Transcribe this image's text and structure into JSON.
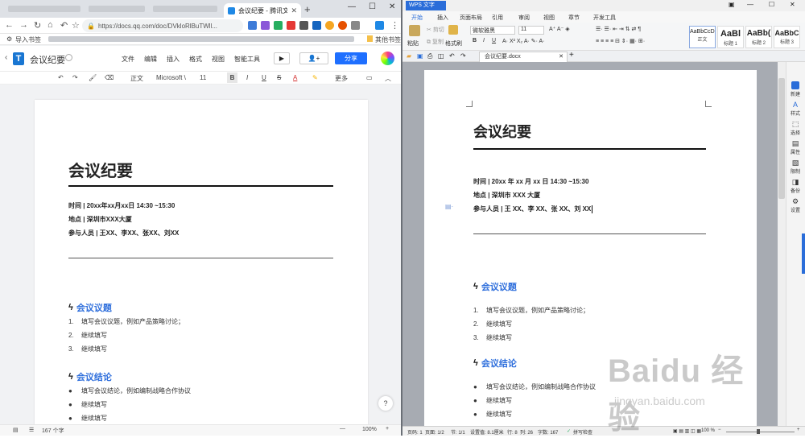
{
  "browser": {
    "tab_title": "会议纪要 - 腾讯文档",
    "url": "https://docs.qq.com/doc/DVkloRlBuTWll...",
    "bookmarks": {
      "import": "导入书签",
      "other": "其他书签"
    },
    "colors": {
      "tab_bg": "#dee1e6",
      "tab_icon": "#1e88e5"
    }
  },
  "tencent_doc": {
    "title": "会议纪要",
    "menu": [
      "文件",
      "编辑",
      "插入",
      "格式",
      "视图",
      "智能工具"
    ],
    "share_label": "分享",
    "toolbar": {
      "style": "正文",
      "font": "Microsoft \\",
      "size": "11",
      "more": "更多"
    },
    "status": {
      "word_count": "167 个字",
      "zoom": "100%"
    },
    "help_label": "?",
    "colors": {
      "brand": "#1976d2",
      "share": "#1e6fff",
      "section": "#2f6fdc"
    }
  },
  "doc_left": {
    "heading": "会议纪要",
    "time": "时间 | 20xx年xx月xx日  14:30 ~15:30",
    "place": "地点 | 深圳市XXX大厦",
    "people": "参与人员 | 王XX、李XX、张XX、刘XX",
    "topics_title": "会议议题",
    "topics": [
      "填写会议议题，例如产品策略讨论；",
      "继续填写",
      "继续填写"
    ],
    "conclusion_title": "会议结论",
    "conclusions": [
      "填写会议结论，例如编制战略合作协议",
      "继续填写",
      "继续填写"
    ]
  },
  "wps": {
    "app_badge": "WPS 文字",
    "ribbon_tabs": [
      "开始",
      "插入",
      "页面布局",
      "引用",
      "审阅",
      "视图",
      "章节",
      "开发工具"
    ],
    "ribbon": {
      "paste": "粘贴",
      "cut": "剪切",
      "copy": "复制",
      "format_painter": "格式刷",
      "font": "微软雅黑",
      "size": "11"
    },
    "styles": [
      {
        "preview": "AaBbCcDd",
        "name": "正文"
      },
      {
        "preview": "AaBl",
        "name": "标题 1"
      },
      {
        "preview": "AaBb(",
        "name": "标题 2"
      },
      {
        "preview": "AaBbC",
        "name": "标题 3"
      }
    ],
    "doc_tab": "会议纪要.docx",
    "side_panel": [
      "新建",
      "样式",
      "选择",
      "属性",
      "限制",
      "备份",
      "设置"
    ],
    "status": {
      "page": "页码: 1",
      "pages": "页面: 1/2",
      "section": "节: 1/1",
      "setting": "设置值: 8.1厘米",
      "row": "行: 8",
      "col": "列: 26",
      "words": "字数: 167",
      "spell": "拼写检查",
      "zoom": "100 %"
    },
    "colors": {
      "brand": "#2a6dd9",
      "canvas": "#a7abb2"
    }
  },
  "doc_right": {
    "heading": "会议纪要",
    "time": "时间 | 20xx 年 xx 月 xx 日   14:30 ~15:30",
    "place": "地点 | 深圳市 XXX 大厦",
    "people": "参与人员 | 王 XX、李 XX、张 XX、刘 XX",
    "topics_title": "会议议题",
    "topics": [
      "填写会议议题，例如产品策略讨论；",
      "继续填写",
      "继续填写"
    ],
    "conclusion_title": "会议结论",
    "conclusions": [
      "填写会议结论，例如编制战略合作协议",
      "继续填写",
      "继续填写"
    ]
  },
  "watermark": {
    "brand": "Baidu 经验",
    "url": "jingyan.baidu.com"
  }
}
